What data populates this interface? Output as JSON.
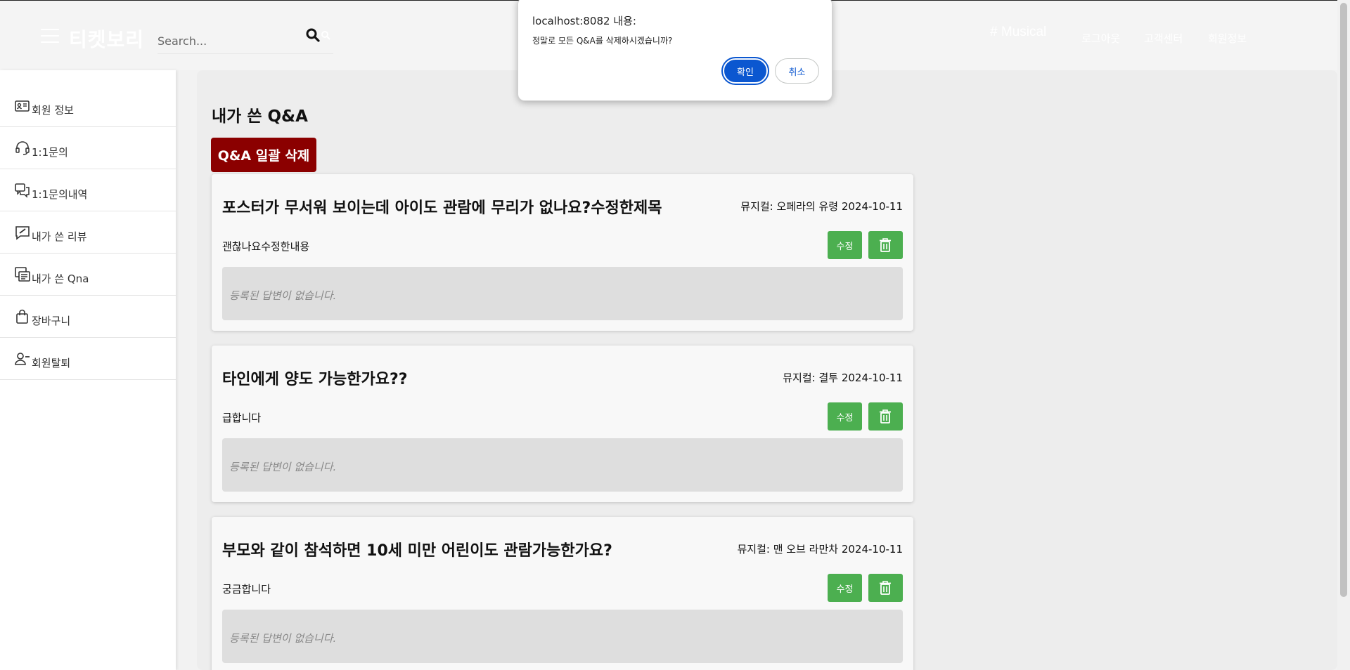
{
  "header": {
    "logo": "티켓보리",
    "search_placeholder": "Search...",
    "tag": "# Musical",
    "nav": [
      "로그아웃",
      "고객센터",
      "회원정보"
    ]
  },
  "sidebar": {
    "items": [
      {
        "label": "회원 정보",
        "icon": "id-card-icon"
      },
      {
        "label": "1:1문의",
        "icon": "headset-icon"
      },
      {
        "label": "1:1문의내역",
        "icon": "chat-history-icon"
      },
      {
        "label": "내가 쓴 리뷰",
        "icon": "review-icon"
      },
      {
        "label": "내가 쓴 Qna",
        "icon": "qna-list-icon"
      },
      {
        "label": "장바구니",
        "icon": "shopping-bag-icon"
      },
      {
        "label": "회원탈퇴",
        "icon": "user-remove-icon"
      }
    ]
  },
  "main": {
    "title": "내가 쓴 Q&A",
    "bulk_delete_label": "Q&A 일괄 삭제",
    "edit_label": "수정",
    "no_answer": "등록된 답변이 없습니다.",
    "qna": [
      {
        "title": "포스터가 무서워 보이는데 아이도 관람에 무리가 없나요?수정한제목",
        "meta": "뮤지컬: 오페라의 유령  2024-10-11",
        "content": "괜찮나요수정한내용"
      },
      {
        "title": "타인에게 양도 가능한가요??",
        "meta": "뮤지컬: 결투  2024-10-11",
        "content": "급합니다"
      },
      {
        "title": "부모와 같이 참석하면 10세 미만 어린이도 관람가능한가요?",
        "meta": "뮤지컬: 맨 오브 라만차  2024-10-11",
        "content": "궁금합니다"
      }
    ]
  },
  "dialog": {
    "title": "localhost:8082 내용:",
    "message": "정말로 모든 Q&A를 삭제하시겠습니까?",
    "ok_label": "확인",
    "cancel_label": "취소"
  },
  "colors": {
    "bulk_delete": "#8b0000",
    "action_button": "#4caf50",
    "dialog_primary": "#0b57d0"
  }
}
